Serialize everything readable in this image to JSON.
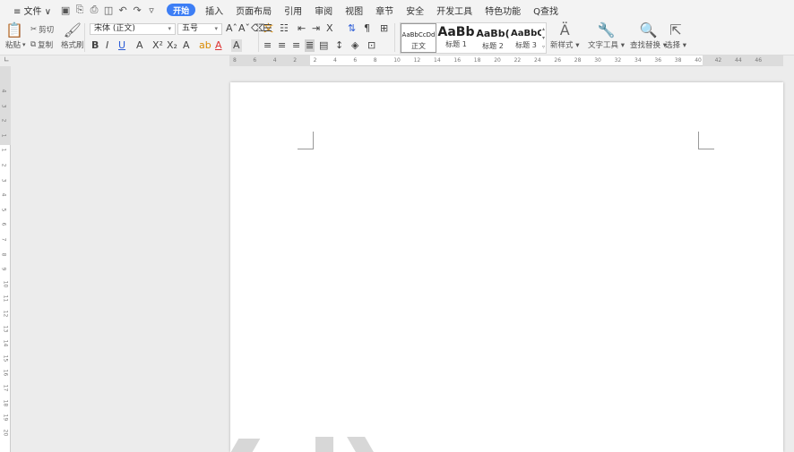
{
  "menubar": {
    "file": "≡ 文件 ∨",
    "start": "开始",
    "tabs": [
      "插入",
      "页面布局",
      "引用",
      "审阅",
      "视图",
      "章节",
      "安全",
      "开发工具",
      "特色功能"
    ],
    "search": "Q查找"
  },
  "ribbon": {
    "paste": "粘贴",
    "cut": "剪切",
    "copy": "复制",
    "format_painter": "格式刷",
    "font_name": "宋体 (正文)",
    "font_size": "五号",
    "styles": [
      {
        "preview": "AaBbCcDd",
        "name": "正文"
      },
      {
        "preview": "AaBb",
        "name": "标题 1"
      },
      {
        "preview": "AaBb(",
        "name": "标题 2"
      },
      {
        "preview": "AaBbC",
        "name": "标题 3"
      }
    ],
    "new_style": "新样式",
    "text_tools": "文字工具",
    "find_replace": "查找替换",
    "select": "选择"
  },
  "hruler_ticks": [
    "8",
    "6",
    "4",
    "2",
    "2",
    "4",
    "6",
    "8",
    "10",
    "12",
    "14",
    "16",
    "18",
    "20",
    "22",
    "24",
    "26",
    "28",
    "30",
    "32",
    "34",
    "36",
    "38",
    "40",
    "42",
    "44",
    "46"
  ],
  "vruler_ticks": [
    "4",
    "3",
    "2",
    "1",
    "1",
    "2",
    "3",
    "4",
    "5",
    "6",
    "7",
    "8",
    "9",
    "10",
    "11",
    "12",
    "13",
    "14",
    "15",
    "16",
    "17",
    "18",
    "19",
    "20"
  ]
}
